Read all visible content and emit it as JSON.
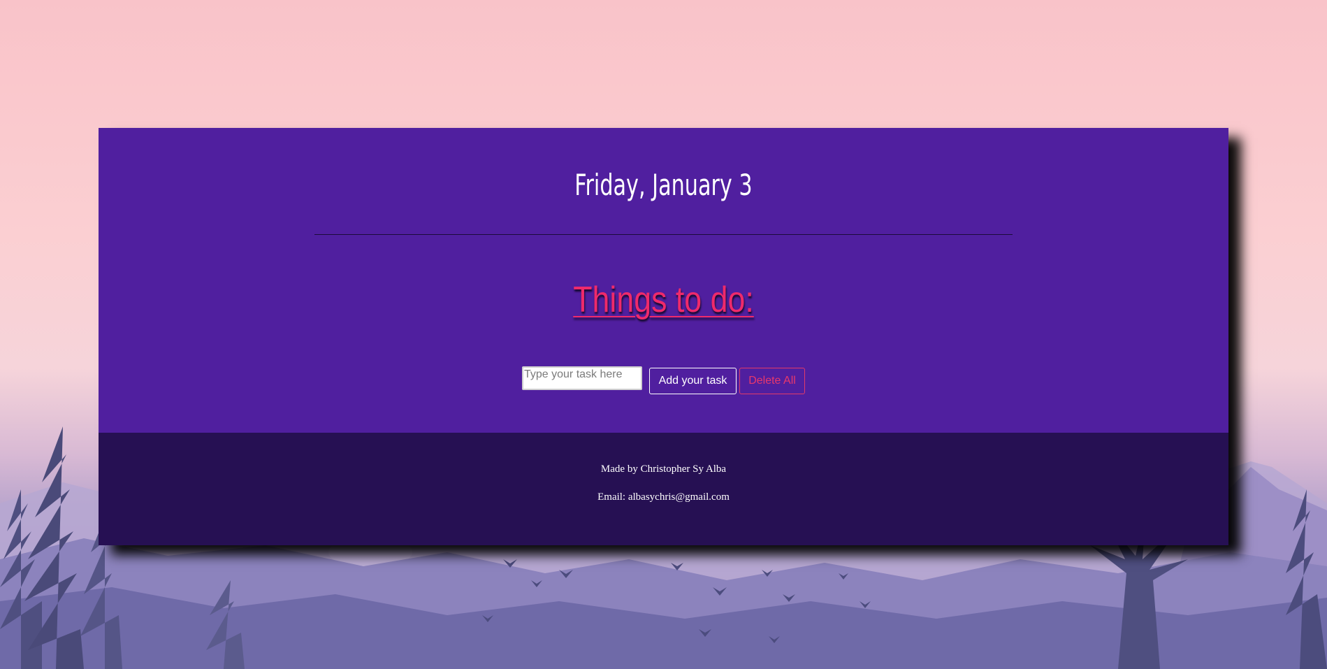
{
  "header": {
    "date": "Friday, January 3"
  },
  "main": {
    "heading": "Things to do:",
    "task_input": {
      "value": "",
      "placeholder": "Type your task here"
    },
    "add_button_label": "Add your task",
    "delete_all_label": "Delete All"
  },
  "footer": {
    "made_by": "Made by Christopher Sy Alba",
    "email": "Email: albasychris@gmail.com"
  },
  "colors": {
    "card_main": "#501f9f",
    "card_footer": "#261053",
    "heading_accent": "#ef2a6b",
    "delete_accent": "#e23a6a"
  },
  "icons": {
    "background_scene": "mountain-forest-sunset-with-birds"
  }
}
